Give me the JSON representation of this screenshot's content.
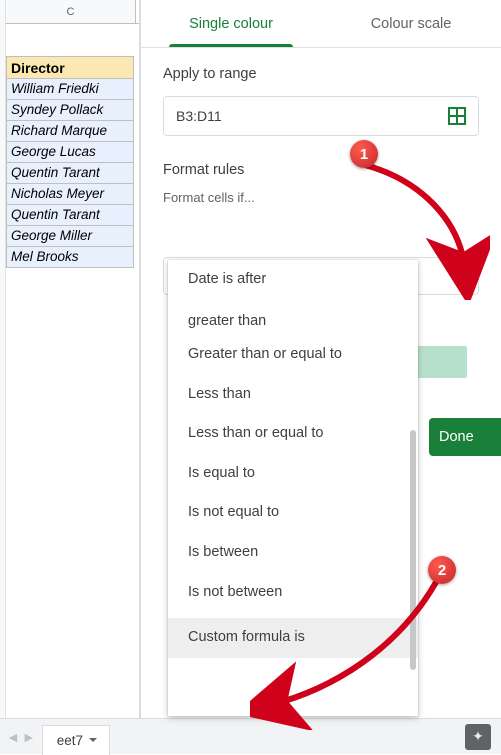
{
  "spreadsheet": {
    "column_letter": "C",
    "header": "Director",
    "rows": [
      "William Friedki",
      "Syndey Pollack",
      "Richard Marque",
      "George Lucas",
      "Quentin Tarant",
      "Nicholas Meyer",
      "Quentin Tarant",
      "George Miller",
      "Mel Brooks"
    ]
  },
  "panel": {
    "tabs": {
      "single": "Single colour",
      "scale": "Colour scale"
    },
    "apply_label": "Apply to range",
    "range": "B3:D11",
    "rules_label": "Format rules",
    "hint": "Format cells if...",
    "menu": [
      "Date is after",
      "greater than",
      "Greater than or equal to",
      "Less than",
      "Less than or equal to",
      "Is equal to",
      "Is not equal to",
      "Is between",
      "Is not between",
      "Custom formula is"
    ],
    "done": "Done"
  },
  "bottom": {
    "sheet": "eet7"
  },
  "annotations": {
    "one": "1",
    "two": "2"
  }
}
